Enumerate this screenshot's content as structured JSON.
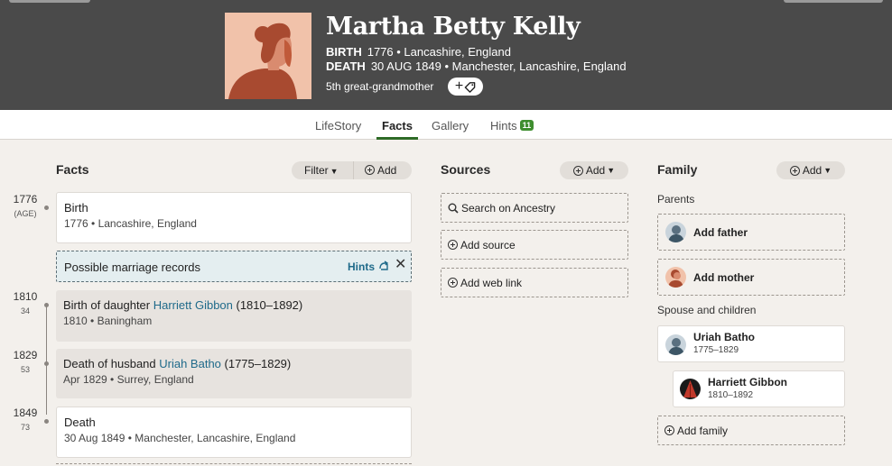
{
  "profile": {
    "name": "Martha Betty Kelly",
    "birth_label": "BIRTH",
    "birth_value": "1776 • Lancashire, England",
    "death_label": "DEATH",
    "death_value": "30 AUG 1849 • Manchester, Lancashire, England",
    "relationship": "5th great-grandmother",
    "tag_plus": "+"
  },
  "tabs": [
    {
      "label": "LifeStory"
    },
    {
      "label": "Facts"
    },
    {
      "label": "Gallery"
    },
    {
      "label": "Hints",
      "badge": "11"
    }
  ],
  "facts": {
    "title": "Facts",
    "filter_label": "Filter",
    "add_label": "Add",
    "timeline": [
      {
        "year": "1776",
        "age": "(AGE)"
      },
      {
        "year": "1810",
        "age": "34"
      },
      {
        "year": "1829",
        "age": "53"
      },
      {
        "year": "1849",
        "age": "73"
      }
    ],
    "birth": {
      "title": "Birth",
      "detail": "1776 • Lancashire, England"
    },
    "hint": {
      "text": "Possible marriage records",
      "link": "Hints",
      "close": "✕"
    },
    "daughter": {
      "prefix": "Birth of daughter ",
      "name": "Harriett Gibbon",
      "years": " (1810–1892)",
      "detail": "1810 • Baningham"
    },
    "husband": {
      "prefix": "Death of husband ",
      "name": "Uriah Batho",
      "years": " (1775–1829)",
      "detail": "Apr 1829 • Surrey, England"
    },
    "death": {
      "title": "Death",
      "detail": "30 Aug 1849 • Manchester, Lancashire, England"
    }
  },
  "sources": {
    "title": "Sources",
    "add_label": "Add",
    "items": [
      {
        "label": "Search on Ancestry",
        "icon": "search-icon"
      },
      {
        "label": "Add source",
        "icon": "plus-circle-icon"
      },
      {
        "label": "Add web link",
        "icon": "plus-circle-icon"
      }
    ]
  },
  "family": {
    "title": "Family",
    "add_label": "Add",
    "parents_label": "Parents",
    "add_father": "Add father",
    "add_mother": "Add mother",
    "spouse_label": "Spouse and children",
    "spouse": {
      "name": "Uriah Batho",
      "dates": "1775–1829"
    },
    "child": {
      "name": "Harriett Gibbon",
      "dates": "1810–1892"
    },
    "add_family": "Add family"
  },
  "colors": {
    "header_bg": "#4a4a4a",
    "link": "#1f6a8a",
    "tab_active": "#2e6b26",
    "badge": "#3f8e2f"
  }
}
